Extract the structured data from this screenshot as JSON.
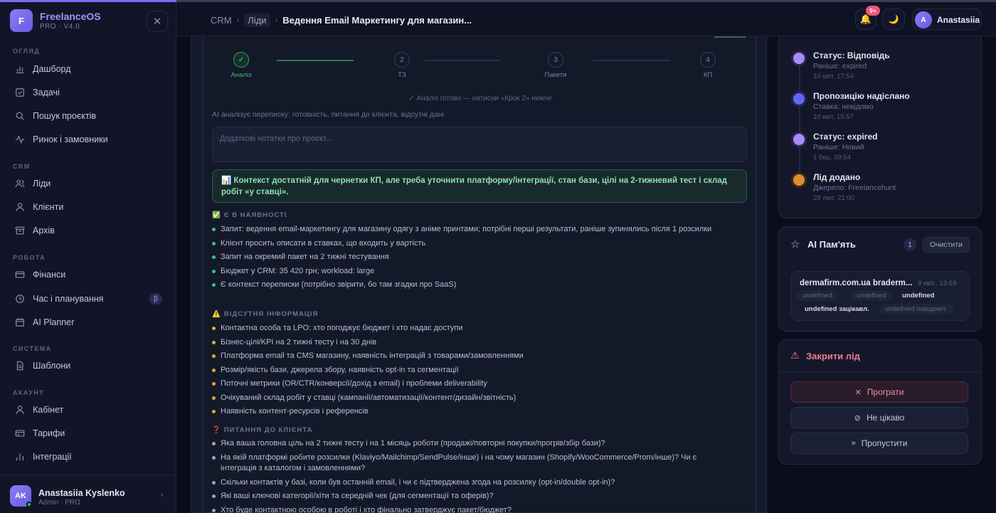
{
  "brand": {
    "logo_letter": "F",
    "name": "FreelanceOS",
    "version": "PRO · V4.0"
  },
  "sidebar": {
    "sections": [
      {
        "title": "ОГЛЯД",
        "items": [
          {
            "label": "Дашборд",
            "icon": "chart-bar-icon"
          },
          {
            "label": "Задачі",
            "icon": "checkbox-icon"
          },
          {
            "label": "Пошук проєктів",
            "icon": "search-icon"
          },
          {
            "label": "Ринок і замовники",
            "icon": "activity-icon"
          }
        ]
      },
      {
        "title": "CRM",
        "items": [
          {
            "label": "Ліди",
            "icon": "users-icon"
          },
          {
            "label": "Клієнти",
            "icon": "user-icon"
          },
          {
            "label": "Архів",
            "icon": "archive-icon"
          }
        ]
      },
      {
        "title": "РОБОТА",
        "items": [
          {
            "label": "Фінанси",
            "icon": "wallet-icon"
          },
          {
            "label": "Час і планування",
            "icon": "clock-icon",
            "badge": "β"
          },
          {
            "label": "AI Planner",
            "icon": "calendar-icon"
          }
        ]
      },
      {
        "title": "СИСТЕМА",
        "items": [
          {
            "label": "Шаблони",
            "icon": "document-icon"
          }
        ]
      },
      {
        "title": "АКАУНТ",
        "items": [
          {
            "label": "Кабінет",
            "icon": "user-icon"
          },
          {
            "label": "Тарифи",
            "icon": "credit-card-icon"
          },
          {
            "label": "Інтеграції",
            "icon": "bar-chart-icon"
          }
        ]
      }
    ]
  },
  "user": {
    "initials": "AK",
    "name": "Anastasiia Kyslenko",
    "role": "Admin · PRO"
  },
  "header": {
    "crumb1": "CRM",
    "crumb2": "Ліди",
    "crumb3": "Ведення Email Маркетингу для магазин...",
    "notifications": "9+",
    "profile_initial": "A",
    "profile_name": "Anastasiia"
  },
  "steps": [
    {
      "num": "✓",
      "label": "Аналіз",
      "done": true
    },
    {
      "num": "2",
      "label": "ТЗ"
    },
    {
      "num": "3",
      "label": "Пакети"
    },
    {
      "num": "4",
      "label": "КП"
    }
  ],
  "analysis": {
    "ready_text": "✓ Аналіз готово — натисни «Крок 2» нижче",
    "description": "AI аналізує переписку: готовність, питання до клієнта, відсутні дані.",
    "notes_placeholder": "Додаткові нотатки про проєкт...",
    "context_text": "📊 Контекст достатній для чернетки КП, але треба уточнити платформу/інтеграції, стан бази, цілі на 2-тижневий тест і склад робіт «у ставці».",
    "available_title": "Є В НАЯВНОСТІ",
    "available_emoji": "✅",
    "available": [
      "Запит: ведення email-маркетингу для магазину одягу з аніме принтами; потрібні перші результати, раніше зупинялись після 1 розсилки",
      "Клієнт просить описати в ставках, що входить у вартість",
      "Запит на окремий пакет на 2 тижні тестування",
      "Бюджет у CRM: 35 420 грн; workload: large",
      "Є контекст переписки (потрібно звірити, бо там згадки про SaaS)"
    ],
    "missing_title": "ВІДСУТНЯ ІНФОРМАЦІЯ",
    "missing_emoji": "⚠️",
    "missing": [
      "Контактна особа та LPO: хто погоджує бюджет і хто надає доступи",
      "Бізнес-цілі/KPI на 2 тижні тесту і на 30 днів",
      "Платформа email та CMS магазину, наявність інтеграцій з товарами/замовленнями",
      "Розмір/якість бази, джерела збору, наявність opt-in та сегментації",
      "Поточні метрики (OR/CTR/конверсії/дохід з email) і проблеми deliverability",
      "Очікуваний склад робіт у ставці (кампанії/автоматизації/контент/дизайн/звітність)",
      "Наявність контент-ресурсів і референсів"
    ],
    "questions_title": "ПИТАННЯ ДО КЛІЄНТА",
    "questions_emoji": "❓",
    "questions": [
      "Яка ваша головна ціль на 2 тижні тесту і на 1 місяць роботи (продажі/повторні покупки/прогрів/збір бази)?",
      "На якій платформі робите розсилки (Klaviyo/Mailchimp/SendPulse/інше) і на чому магазин (Shopify/WooCommerce/Prom/інше)? Чи є інтеграція з каталогом і замовленнями?",
      "Скільки контактів у базі, коли був останній email, і чи є підтверджена згода на розсилку (opt-in/double opt-in)?",
      "Які ваші ключові категорії/хіти та середній чек (для сегментації та оферів)?",
      "Хто буде контактною особою в роботі і хто фінально затверджує пакет/бюджет?"
    ]
  },
  "timeline": [
    {
      "title": "Статус: Відповідь",
      "sub": "Раніше: expired",
      "time": "10 квіт, 17:54",
      "color": "#a78bfa"
    },
    {
      "title": "Пропозицію надіслано",
      "sub": "Ставка: невідомо",
      "time": "10 квіт, 15:57",
      "color": "#6366f1"
    },
    {
      "title": "Статус: expired",
      "sub": "Раніше: Новий",
      "time": "1 бер, 09:54",
      "color": "#a78bfa"
    },
    {
      "title": "Лід додано",
      "sub": "Джерело: Freelancehunt",
      "time": "28 лют, 21:00",
      "color": "#e08a2e"
    }
  ],
  "memory": {
    "title": "AI Пам'ять",
    "count": "1",
    "clear_label": "Очистити",
    "entry_domain": "dermafirm.com.ua braderm...",
    "entry_date": "9 квіт., 13:59",
    "tag1": "undefined",
    "tag2": "undefined",
    "tag3": "undefined",
    "tag4": "undefined зацікавл.",
    "tag5": "undefined повідомл."
  },
  "close_lead": {
    "title": "Закрити лід",
    "lost_label": "Програти",
    "not_interested_label": "Не цікаво",
    "skip_label": "Пропустити"
  },
  "colors": {
    "accent": "#7c6cf2",
    "success": "#34c77b",
    "warning": "#e3a935",
    "danger": "#f27b8f"
  }
}
